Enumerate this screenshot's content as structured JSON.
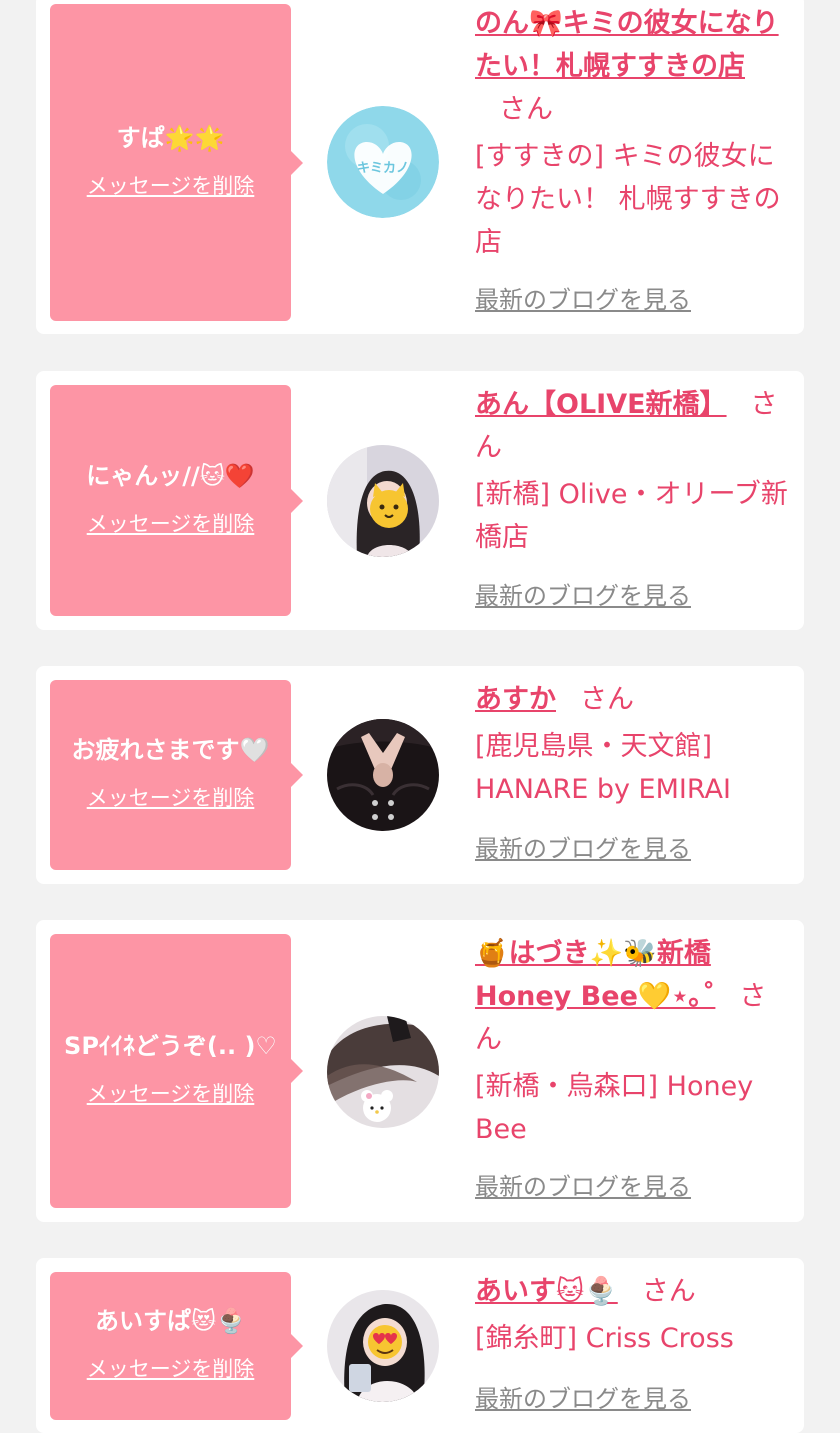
{
  "labels": {
    "delete_message": "メッセージを削除",
    "san": "さん",
    "latest_blog": "最新のブログを見る"
  },
  "colors": {
    "bubble": "#fd95a5",
    "link": "#e8446b",
    "muted": "#8a8a8a",
    "page_bg": "#f2f2f2"
  },
  "cards": [
    {
      "message": "すぱ🌟🌟",
      "name": "のん🎀キミの彼女になりたい！札幌すすきの店",
      "shop": "[すすきの] キミの彼女になりたい！ 札幌すすきの店",
      "avatar": "kimikano-logo"
    },
    {
      "message": "にゃんッ//🐱❤️",
      "name": "あん【OLIVE新橋】",
      "shop": "[新橋] Olive・オリーブ新橋店",
      "avatar": "girl-cat-face-photo"
    },
    {
      "message": "お疲れさまです🤍",
      "name": "あすか",
      "shop": "[鹿児島県・天文館] HANARE by EMIRAI",
      "avatar": "black-dress-photo"
    },
    {
      "message": "SPｲｲﾈどうぞ(.. )♡",
      "name": "🍯はづき✨🐝新橋Honey Bee💛⋆｡˚",
      "shop": "[新橋・烏森口] Honey Bee",
      "avatar": "hair-plush-photo"
    },
    {
      "message": "あいすぱ😻🍨",
      "name": "あいす🐱🍨",
      "shop": "[錦糸町] Criss Cross",
      "avatar": "heart-eyes-photo"
    }
  ]
}
